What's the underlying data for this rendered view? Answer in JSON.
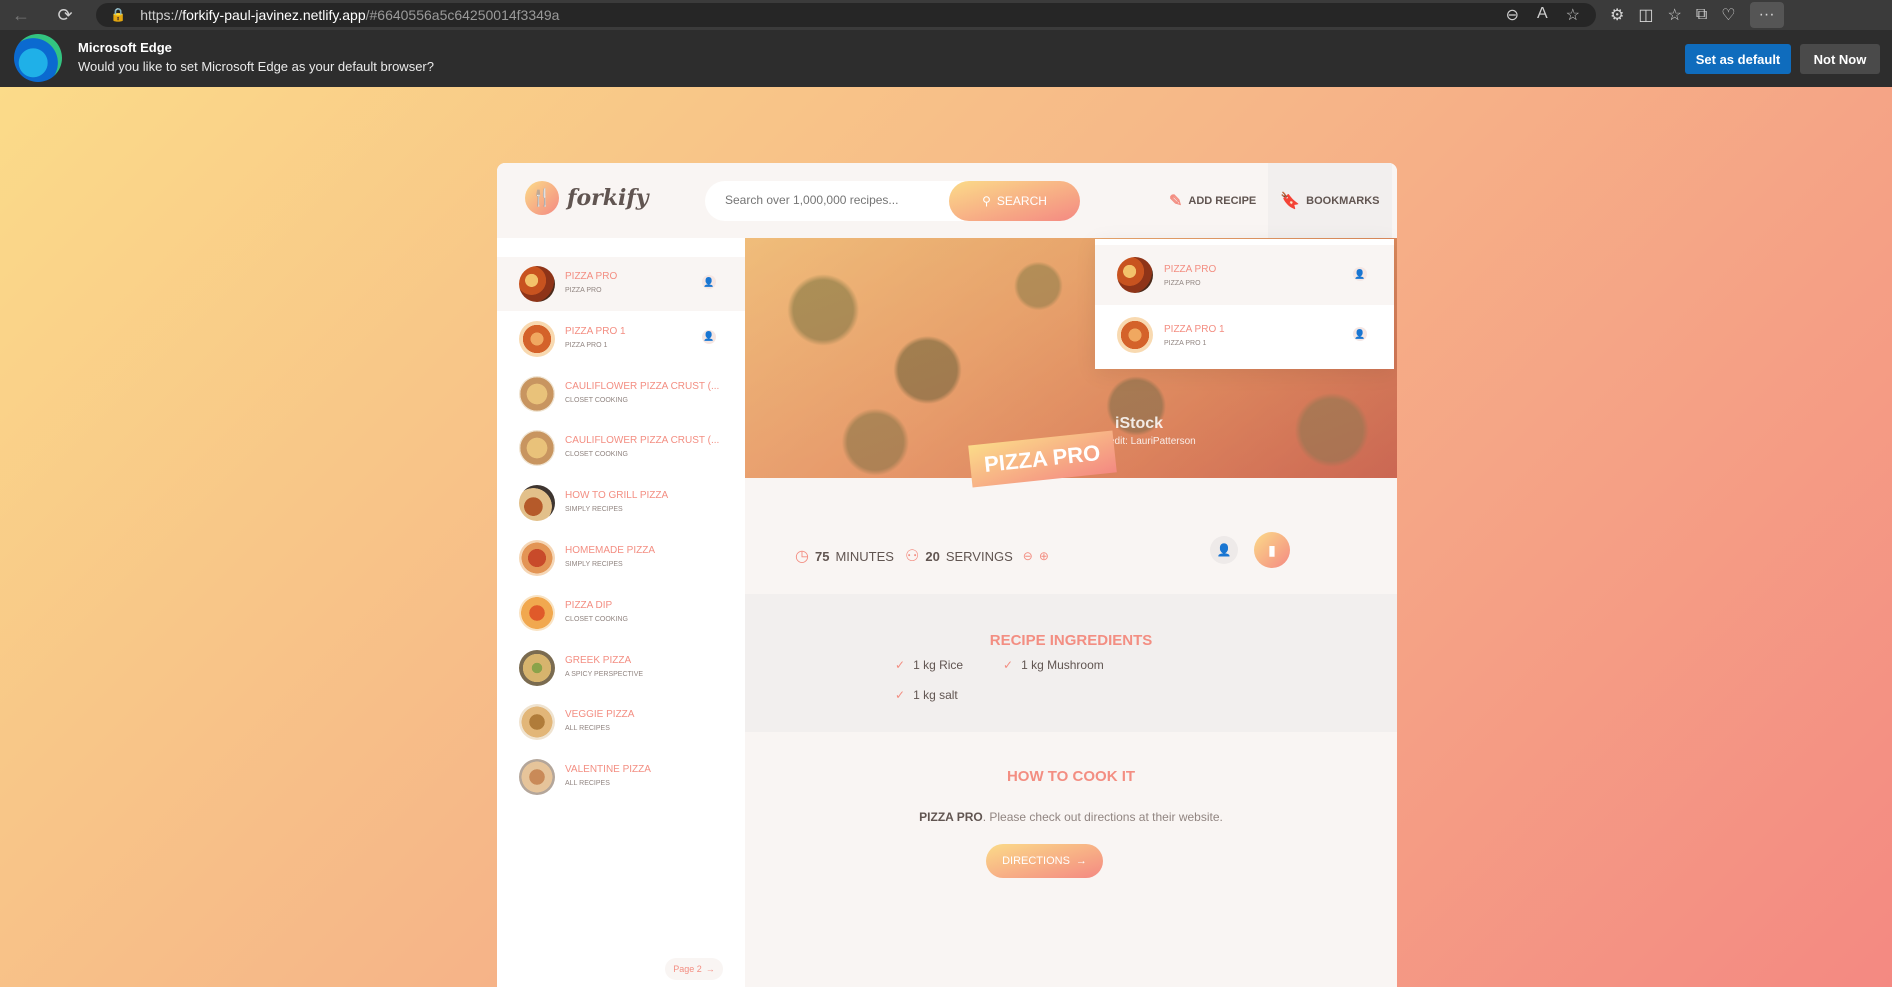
{
  "browser": {
    "url_scheme": "https://",
    "url_host": "forkify-paul-javinez.netlify.app",
    "url_hash": "/#6640556a5c64250014f3349a"
  },
  "infobar": {
    "title": "Microsoft Edge",
    "message": "Would you like to set Microsoft Edge as your default browser?",
    "set_default": "Set as default",
    "not_now": "Not Now"
  },
  "app": {
    "logo": "forkify",
    "search_placeholder": "Search over 1,000,000 recipes...",
    "search_button": "SEARCH",
    "nav_add_recipe": "ADD RECIPE",
    "nav_bookmarks": "BOOKMARKS"
  },
  "results": [
    {
      "title": "PIZZA PRO",
      "publisher": "PIZZA PRO",
      "user": true,
      "active": true
    },
    {
      "title": "PIZZA PRO 1",
      "publisher": "PIZZA PRO 1",
      "user": true,
      "active": false
    },
    {
      "title": "CAULIFLOWER PIZZA CRUST (...",
      "publisher": "CLOSET COOKING",
      "user": false,
      "active": false
    },
    {
      "title": "CAULIFLOWER PIZZA CRUST (...",
      "publisher": "CLOSET COOKING",
      "user": false,
      "active": false
    },
    {
      "title": "HOW TO GRILL PIZZA",
      "publisher": "SIMPLY RECIPES",
      "user": false,
      "active": false
    },
    {
      "title": "HOMEMADE PIZZA",
      "publisher": "SIMPLY RECIPES",
      "user": false,
      "active": false
    },
    {
      "title": "PIZZA DIP",
      "publisher": "CLOSET COOKING",
      "user": false,
      "active": false
    },
    {
      "title": "GREEK PIZZA",
      "publisher": "A SPICY PERSPECTIVE",
      "user": false,
      "active": false
    },
    {
      "title": "VEGGIE PIZZA",
      "publisher": "ALL RECIPES",
      "user": false,
      "active": false
    },
    {
      "title": "VALENTINE PIZZA",
      "publisher": "ALL RECIPES",
      "user": false,
      "active": false
    }
  ],
  "pagination": {
    "next": "Page 2"
  },
  "recipe": {
    "title": "PIZZA PRO",
    "image_watermark": "iStock",
    "image_credit": "edit: LauriPatterson",
    "minutes": "75",
    "minutes_label": "MINUTES",
    "servings": "20",
    "servings_label": "SERVINGS",
    "ingredients_heading": "RECIPE INGREDIENTS",
    "ingredients": [
      "1 kg Rice",
      "1 kg Mushroom",
      "1 kg salt"
    ],
    "directions_heading": "HOW TO COOK IT",
    "directions_publisher": "PIZZA PRO",
    "directions_text": ". Please check out directions at their website.",
    "directions_button": "DIRECTIONS"
  },
  "bookmarks": [
    {
      "title": "PIZZA PRO",
      "publisher": "PIZZA PRO"
    },
    {
      "title": "PIZZA PRO 1",
      "publisher": "PIZZA PRO 1"
    }
  ],
  "colors": {
    "accent": "#f38e82",
    "gradient_start": "#fbdb89",
    "gradient_end": "#f48982",
    "edge_blue": "#0f6cbd"
  }
}
